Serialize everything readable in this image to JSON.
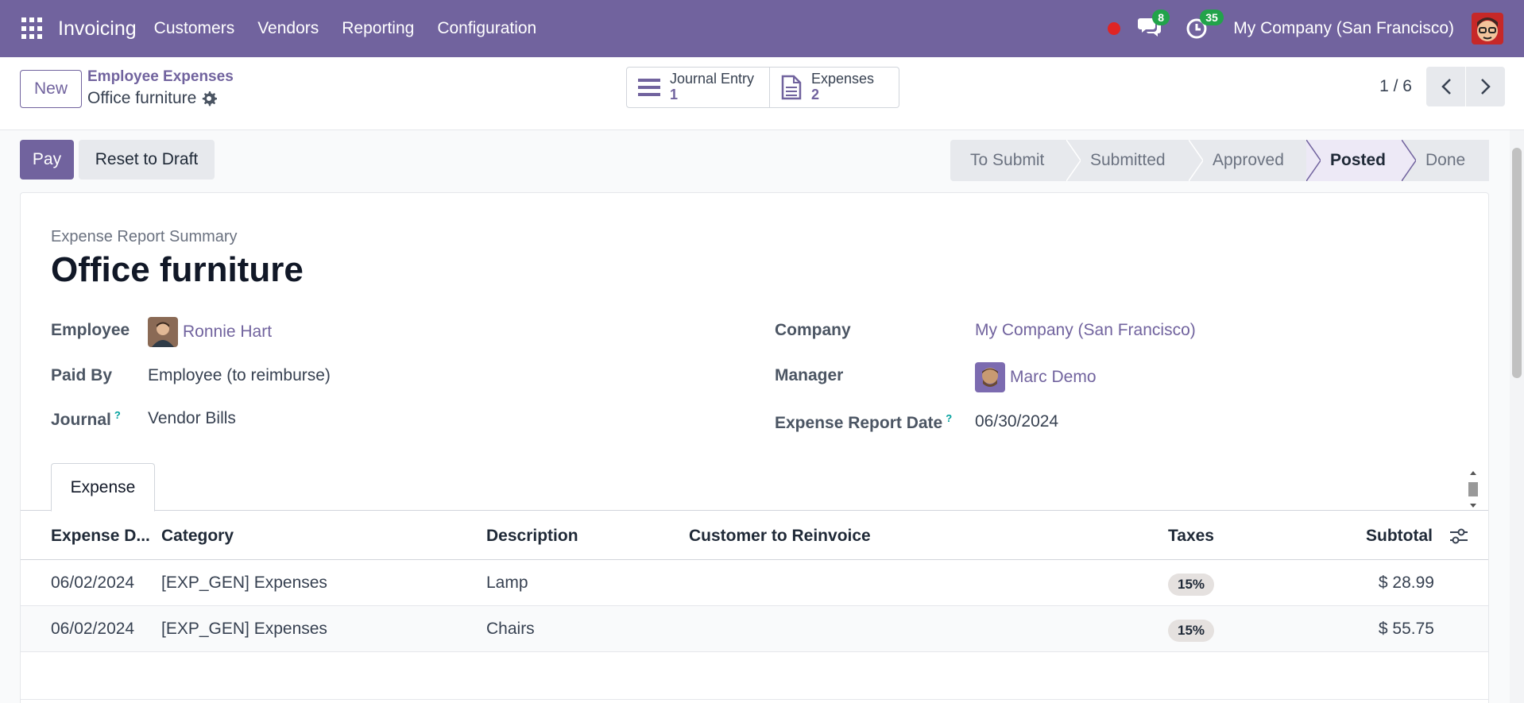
{
  "navbar": {
    "brand": "Invoicing",
    "menu": [
      "Customers",
      "Vendors",
      "Reporting",
      "Configuration"
    ],
    "messages_count": "8",
    "activities_count": "35",
    "company": "My Company (San Francisco)"
  },
  "control": {
    "new_label": "New",
    "breadcrumb_parent": "Employee Expenses",
    "breadcrumb_current": "Office furniture",
    "smart_journal_label": "Journal Entry",
    "smart_journal_value": "1",
    "smart_expenses_label": "Expenses",
    "smart_expenses_value": "2",
    "pager": "1 / 6"
  },
  "status": {
    "pay_label": "Pay",
    "reset_label": "Reset to Draft",
    "stages": [
      "To Submit",
      "Submitted",
      "Approved",
      "Posted",
      "Done"
    ],
    "active_stage": "Posted"
  },
  "form": {
    "subtitle": "Expense Report Summary",
    "title": "Office furniture",
    "employee_label": "Employee",
    "employee_value": "Ronnie Hart",
    "paid_by_label": "Paid By",
    "paid_by_value": "Employee (to reimburse)",
    "journal_label": "Journal",
    "journal_value": "Vendor Bills",
    "company_label": "Company",
    "company_value": "My Company (San Francisco)",
    "manager_label": "Manager",
    "manager_value": "Marc Demo",
    "date_label": "Expense Report Date",
    "date_value": "06/30/2024",
    "help_mark": "?"
  },
  "tabs": [
    "Expense"
  ],
  "table": {
    "headers": [
      "Expense D...",
      "Category",
      "Description",
      "Customer to Reinvoice",
      "Taxes",
      "Subtotal"
    ],
    "rows": [
      {
        "date": "06/02/2024",
        "category": "[EXP_GEN] Expenses",
        "description": "Lamp",
        "customer": "",
        "tax": "15%",
        "subtotal": "$ 28.99"
      },
      {
        "date": "06/02/2024",
        "category": "[EXP_GEN] Expenses",
        "description": "Chairs",
        "customer": "",
        "tax": "15%",
        "subtotal": "$ 55.75"
      }
    ]
  },
  "colors": {
    "brand": "#71639e",
    "badge": "#22a34a",
    "record": "#e02424"
  }
}
